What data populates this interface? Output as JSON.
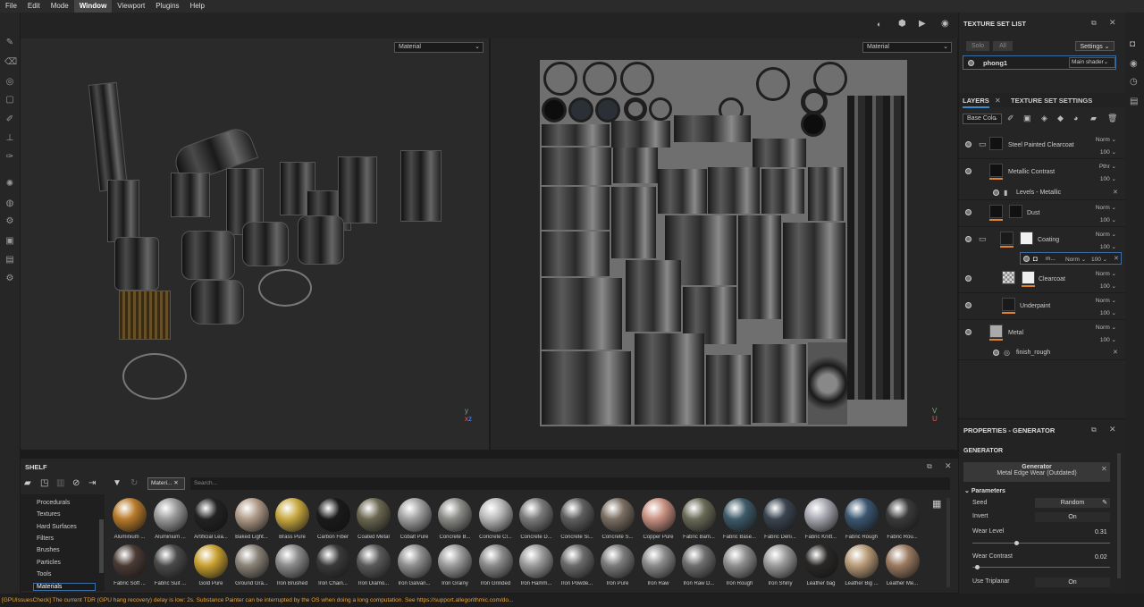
{
  "menu": [
    "File",
    "Edit",
    "Mode",
    "Window",
    "Viewport",
    "Plugins",
    "Help"
  ],
  "menu_active": "Window",
  "viewport3d": {
    "channel": "Material"
  },
  "viewport2d": {
    "channel": "Material"
  },
  "texture_set_list": {
    "title": "TEXTURE SET LIST",
    "solo": "Solo",
    "all": "All",
    "settings": "Settings",
    "set_name": "phong1",
    "shader": "Main shader"
  },
  "tabs": {
    "layers": "LAYERS",
    "texture_set_settings": "TEXTURE SET SETTINGS"
  },
  "layers_toolbar": {
    "channel": "Base Colo"
  },
  "layers": [
    {
      "name": "Steel Painted Clearcoat",
      "blend": "Norm",
      "opacity": "100"
    },
    {
      "name": "Metallic Contrast",
      "blend": "Pthr",
      "opacity": "100",
      "effect": "Levels - Metallic"
    },
    {
      "name": "Dust",
      "blend": "Norm",
      "opacity": "100"
    },
    {
      "name": "Coating",
      "blend": "Norm",
      "opacity": "100",
      "sub": "m...",
      "sub_blend": "Norm",
      "sub_opacity": "100"
    },
    {
      "name": "Clearcoat",
      "blend": "Norm",
      "opacity": "100"
    },
    {
      "name": "Underpaint",
      "blend": "Norm",
      "opacity": "100"
    },
    {
      "name": "Metal",
      "blend": "Norm",
      "opacity": "100",
      "effect": "finish_rough"
    }
  ],
  "properties": {
    "title": "PROPERTIES - GENERATOR",
    "section": "GENERATOR",
    "generator_label": "Generator",
    "generator_value": "Metal Edge Wear (Outdated)",
    "params_label": "Parameters",
    "seed_label": "Seed",
    "seed_value": "Random",
    "invert_label": "Invert",
    "invert_value": "On",
    "wear_level_label": "Wear Level",
    "wear_level_value": "0.31",
    "wear_contrast_label": "Wear Contrast",
    "wear_contrast_value": "0.02",
    "triplanar_label": "Use Triplanar",
    "triplanar_value": "On"
  },
  "shelf": {
    "title": "SHELF",
    "filter_chip": "Materi...",
    "search_placeholder": "Search...",
    "categories": [
      "Procedurals",
      "Textures",
      "Hard Surfaces",
      "Filters",
      "Brushes",
      "Particles",
      "Tools",
      "Materials"
    ],
    "active_category": "Materials",
    "materials_row1": [
      {
        "label": "Aluminium ...",
        "color": "#b87a2a"
      },
      {
        "label": "Aluminium ...",
        "color": "#9a9a9a"
      },
      {
        "label": "Artificial Lea...",
        "color": "#222222"
      },
      {
        "label": "Baked Light...",
        "color": "#b09a88"
      },
      {
        "label": "Brass Pure",
        "color": "#c8a840"
      },
      {
        "label": "Carbon Fiber",
        "color": "#1a1a1a"
      },
      {
        "label": "Coated Metal",
        "color": "#6a6650"
      },
      {
        "label": "Cobalt Pure",
        "color": "#a0a0a0"
      },
      {
        "label": "Concrete B...",
        "color": "#8a8a86"
      },
      {
        "label": "Concrete Cl...",
        "color": "#b8b8b8"
      },
      {
        "label": "Concrete D...",
        "color": "#7a7a7a"
      },
      {
        "label": "Concrete Si...",
        "color": "#5e5e5e"
      },
      {
        "label": "Concrete S...",
        "color": "#7a6e62"
      },
      {
        "label": "Copper Pure",
        "color": "#c89080"
      },
      {
        "label": "Fabric Bam...",
        "color": "#6a6a58"
      },
      {
        "label": "Fabric Base...",
        "color": "#3e5a68"
      },
      {
        "label": "Fabric Deni...",
        "color": "#3a4450"
      },
      {
        "label": "Fabric Knitt...",
        "color": "#a6a6b0"
      },
      {
        "label": "Fabric Rough",
        "color": "#3a5670"
      },
      {
        "label": "Fabric Rou...",
        "color": "#3a3a3a"
      }
    ],
    "materials_row2": [
      {
        "label": "Fabric Soft ...",
        "color": "#4a3a34"
      },
      {
        "label": "Fabric Suit ...",
        "color": "#4a4a4a"
      },
      {
        "label": "Gold Pure",
        "color": "#c8a030"
      },
      {
        "label": "Ground Gra...",
        "color": "#8a8278"
      },
      {
        "label": "Iron Brushed",
        "color": "#8a8a8a"
      },
      {
        "label": "Iron Chain...",
        "color": "#3a3a3a"
      },
      {
        "label": "Iron Diamo...",
        "color": "#5a5a5a"
      },
      {
        "label": "Iron Galvan...",
        "color": "#8e8e8e"
      },
      {
        "label": "Iron Grainy",
        "color": "#9a9a9a"
      },
      {
        "label": "Iron Grinded",
        "color": "#8a8a8a"
      },
      {
        "label": "Iron Hamm...",
        "color": "#9a9a9a"
      },
      {
        "label": "Iron Powde...",
        "color": "#6a6a6a"
      },
      {
        "label": "Iron Pure",
        "color": "#7a7a7a"
      },
      {
        "label": "Iron Raw",
        "color": "#8a8a8a"
      },
      {
        "label": "Iron Raw D...",
        "color": "#6e6e6e"
      },
      {
        "label": "Iron Rough",
        "color": "#8e8e8e"
      },
      {
        "label": "Iron Shiny",
        "color": "#9a9a9a"
      },
      {
        "label": "Leather bag",
        "color": "#2a2826"
      },
      {
        "label": "Leather Big ...",
        "color": "#b89a78"
      },
      {
        "label": "Leather Me...",
        "color": "#9a7a60"
      }
    ]
  },
  "status": "[GPUIssuesCheck] The current TDR (GPU hang recovery) delay is low: 2s. Substance Painter can be interrupted by the OS when doing a long computation. See https://support.allegorithmic.com/do..."
}
